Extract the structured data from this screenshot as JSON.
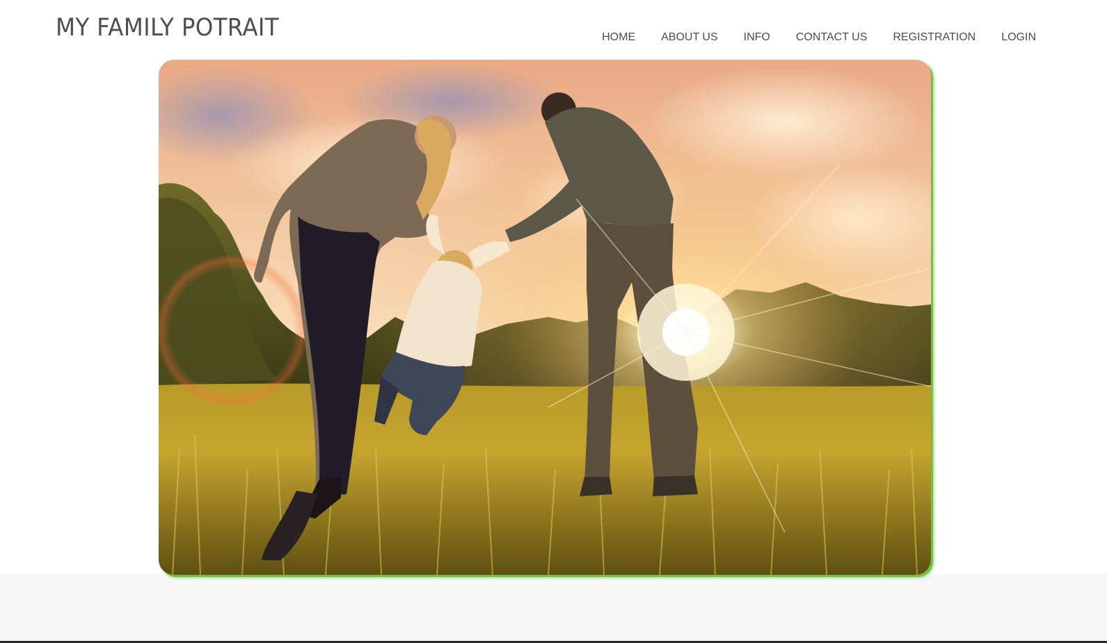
{
  "header": {
    "site_title": "MY FAMILY POTRAIT",
    "nav": [
      {
        "label": "HOME"
      },
      {
        "label": "ABOUT US"
      },
      {
        "label": "INFO"
      },
      {
        "label": "CONTACT US"
      },
      {
        "label": "REGISTRATION"
      },
      {
        "label": "LOGIN"
      }
    ]
  },
  "hero": {
    "image_subject": "family-photo",
    "frame_border_color": "#6fc33f"
  },
  "colors": {
    "text": "#4b4b4b",
    "footer_background": "#f7f7f7",
    "accent_green": "#6fc33f"
  }
}
